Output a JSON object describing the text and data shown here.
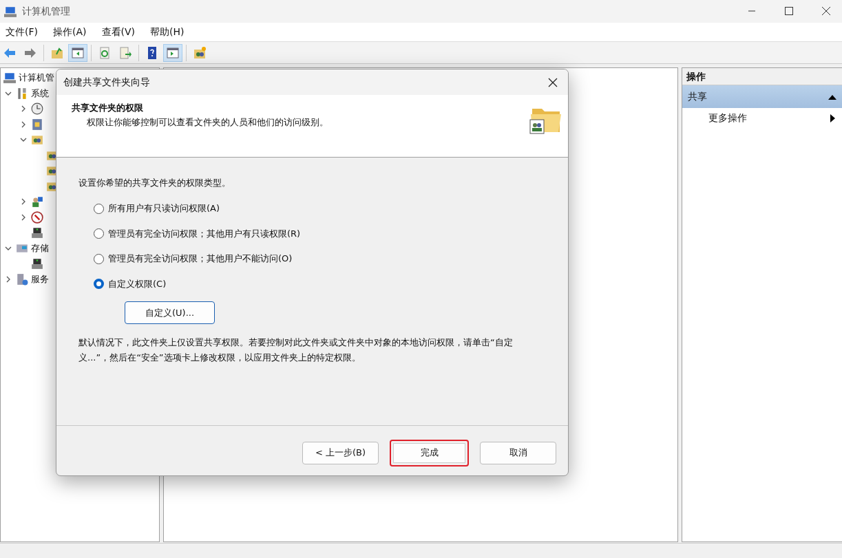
{
  "window": {
    "title": "计算机管理"
  },
  "menu": [
    "文件(F)",
    "操作(A)",
    "查看(V)",
    "帮助(H)"
  ],
  "toolbar": [
    {
      "kind": "back",
      "on": false
    },
    {
      "kind": "forward",
      "on": false
    },
    {
      "kind": "sep"
    },
    {
      "kind": "up",
      "on": false
    },
    {
      "kind": "tree",
      "on": true
    },
    {
      "kind": "sep"
    },
    {
      "kind": "refresh",
      "on": false
    },
    {
      "kind": "export",
      "on": false
    },
    {
      "kind": "sep"
    },
    {
      "kind": "help",
      "on": false
    },
    {
      "kind": "pane",
      "on": true
    },
    {
      "kind": "sep"
    },
    {
      "kind": "share",
      "on": false
    }
  ],
  "tree": [
    {
      "kind": "computer",
      "label": "计算机管",
      "children": [
        {
          "kind": "tools",
          "label": "系统",
          "expanded": true,
          "children": [
            {
              "kind": "clock",
              "expanded": false
            },
            {
              "kind": "event",
              "expanded": false
            },
            {
              "kind": "share",
              "expanded": true,
              "children": [
                {
                  "kind": "share"
                },
                {
                  "kind": "share"
                },
                {
                  "kind": "share"
                }
              ]
            },
            {
              "kind": "users",
              "expanded": false
            },
            {
              "kind": "perf",
              "expanded": false
            },
            {
              "kind": "device"
            }
          ]
        },
        {
          "kind": "storage",
          "label": "存储",
          "expanded": true,
          "children": [
            {
              "kind": "device"
            }
          ]
        },
        {
          "kind": "services",
          "label": "服务",
          "expanded": false
        }
      ]
    }
  ],
  "actions": {
    "title": "操作",
    "section": {
      "label": "共享",
      "expanded": true
    },
    "items": [
      "更多操作"
    ]
  },
  "dialog": {
    "title": "创建共享文件夹向导",
    "heading": "共享文件夹的权限",
    "subheading": "权限让你能够控制可以查看文件夹的人员和他们的访问级别。",
    "prompt": "设置你希望的共享文件夹的权限类型。",
    "options": [
      {
        "label": "所有用户有只读访问权限(A)",
        "selected": false
      },
      {
        "label": "管理员有完全访问权限；其他用户有只读权限(R)",
        "selected": false
      },
      {
        "label": "管理员有完全访问权限；其他用户不能访问(O)",
        "selected": false
      },
      {
        "label": "自定义权限(C)",
        "selected": true
      }
    ],
    "custom_button": "自定义(U)...",
    "note": "默认情况下，此文件夹上仅设置共享权限。若要控制对此文件夹或文件夹中对象的本地访问权限，请单击“自定义...”，然后在“安全”选项卡上修改权限，以应用文件夹上的特定权限。",
    "buttons": [
      {
        "label": "< 上一步(B)",
        "highlighted": false
      },
      {
        "label": "完成",
        "highlighted": true
      },
      {
        "label": "取消",
        "highlighted": false
      }
    ]
  }
}
